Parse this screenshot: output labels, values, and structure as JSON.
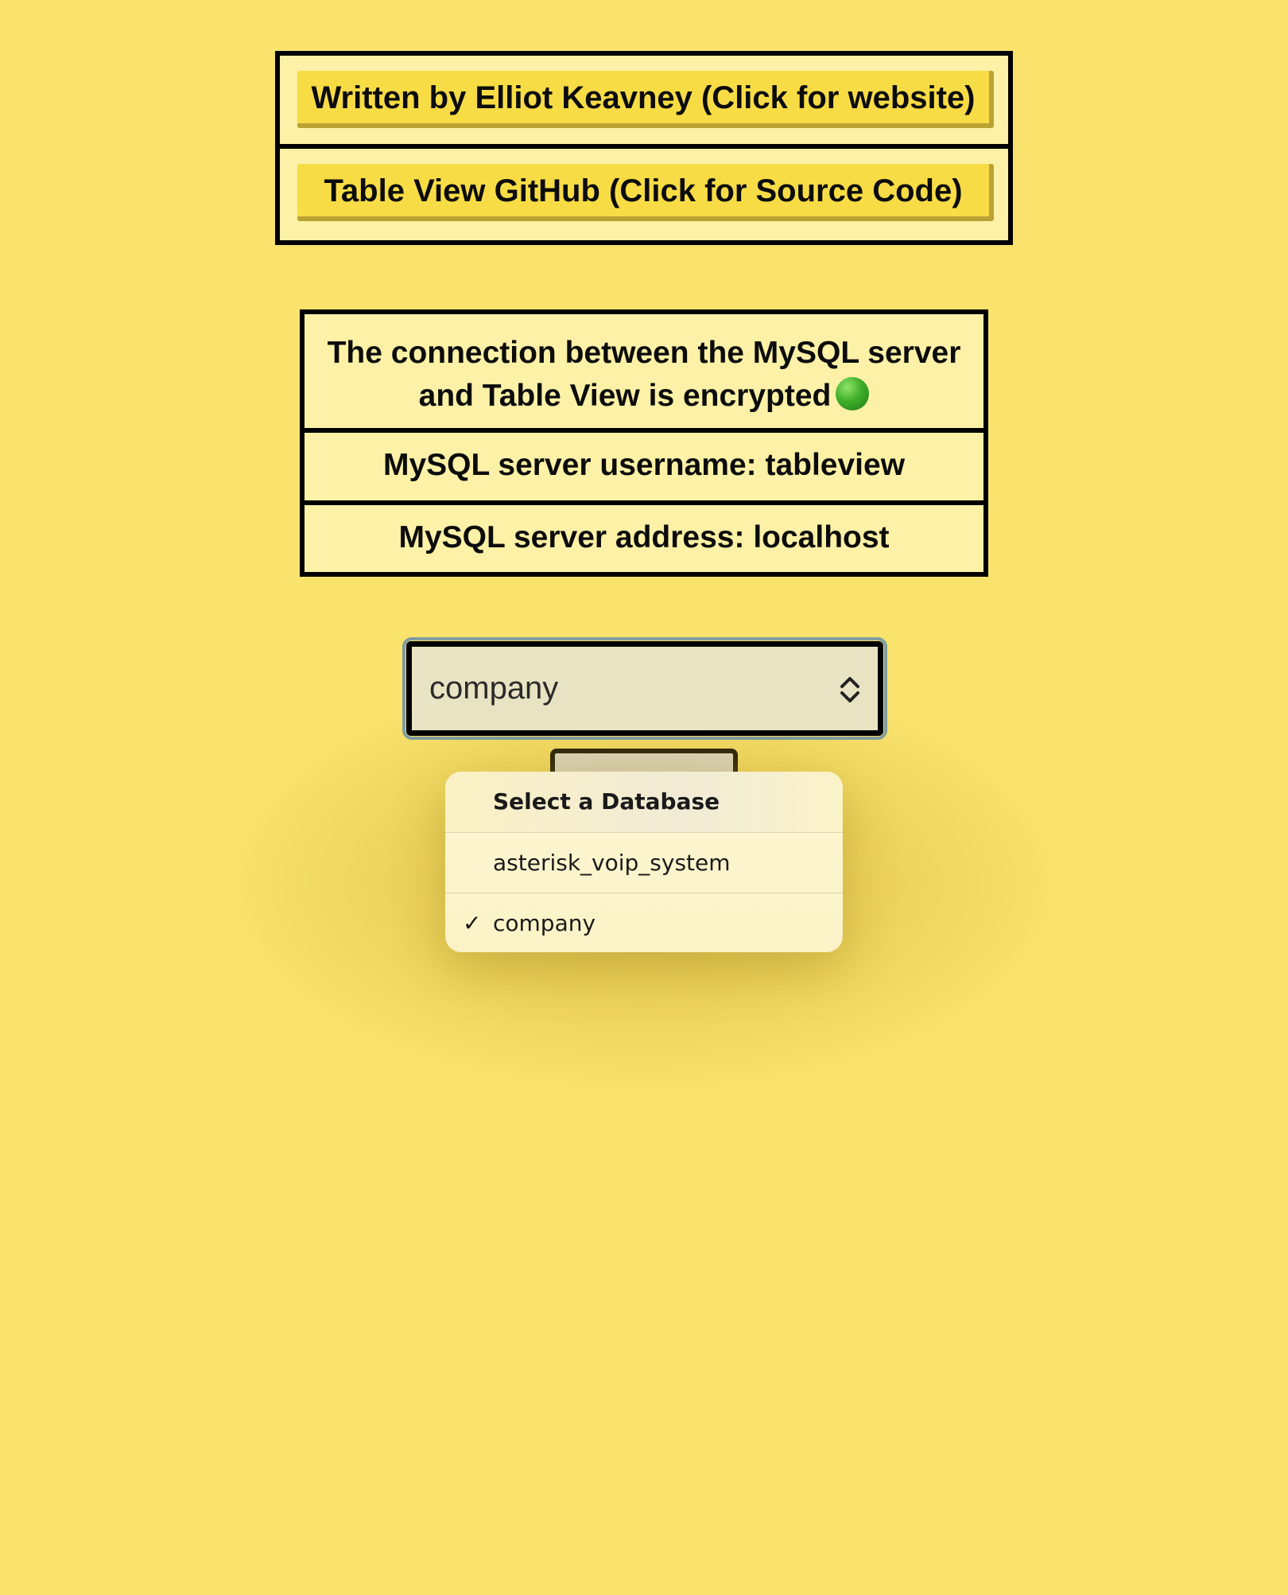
{
  "links": {
    "author_label": "Written by Elliot Keavney (Click for website)",
    "github_label": "Table View GitHub (Click for Source Code)"
  },
  "info": {
    "encryption_line1": "The connection between the MySQL server",
    "encryption_line2": "and Table View is encrypted",
    "encryption_status_icon": "green-circle",
    "username_text": "MySQL server username: tableview",
    "address_text": "MySQL server address: localhost"
  },
  "database_select": {
    "selected_value": "company",
    "options": [
      {
        "label": "Select a Database",
        "selected": false
      },
      {
        "label": "asterisk_voip_system",
        "selected": false
      },
      {
        "label": "company",
        "selected": true
      }
    ],
    "checkmark": "✓"
  },
  "colors": {
    "background": "#f9e36c",
    "panel": "#fcf1a6",
    "button": "#f8dc45",
    "status_green": "#3fae2a"
  }
}
